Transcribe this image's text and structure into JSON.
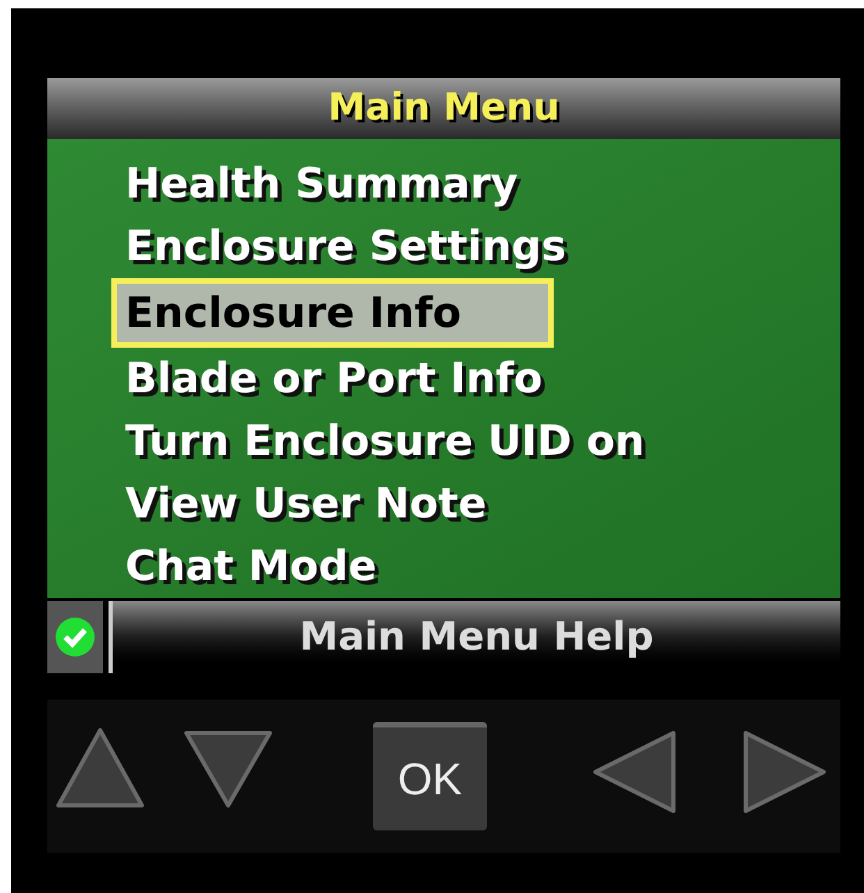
{
  "title": "Main Menu",
  "menu_items": [
    {
      "label": "Health Summary",
      "selected": false
    },
    {
      "label": "Enclosure Settings",
      "selected": false
    },
    {
      "label": "Enclosure Info",
      "selected": true
    },
    {
      "label": "Blade or Port Info",
      "selected": false
    },
    {
      "label": "Turn Enclosure UID on",
      "selected": false
    },
    {
      "label": "View User Note",
      "selected": false
    },
    {
      "label": "Chat Mode",
      "selected": false
    }
  ],
  "help_bar": {
    "label": "Main Menu Help",
    "status_ok": true
  },
  "buttons": [
    {
      "kind": "up"
    },
    {
      "kind": "down"
    },
    {
      "kind": "ok",
      "label": "OK"
    },
    {
      "kind": "left"
    },
    {
      "kind": "right"
    }
  ]
}
